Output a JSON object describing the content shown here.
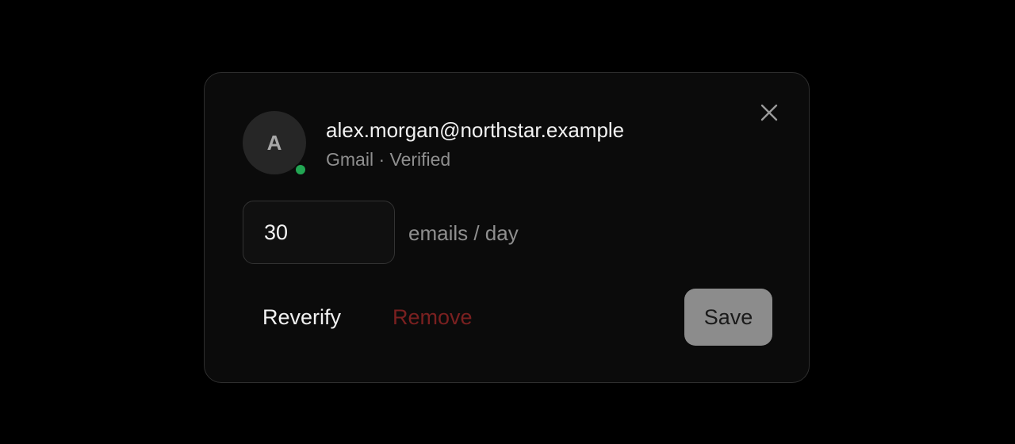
{
  "account": {
    "avatar_initial": "A",
    "email": "alex.morgan@northstar.example",
    "meta": "Gmail · Verified",
    "online": true
  },
  "daily_limit": {
    "value": "30",
    "unit": "emails / day"
  },
  "actions": {
    "reverify_label": "Reverify",
    "remove_label": "Remove",
    "save_label": "Save"
  },
  "icons": {
    "close": "close-icon"
  },
  "colors": {
    "background": "#000000",
    "dialog": "#0b0b0b",
    "status_online": "#22a653",
    "danger": "#7a2020",
    "save_button": "#8c8c8c"
  }
}
